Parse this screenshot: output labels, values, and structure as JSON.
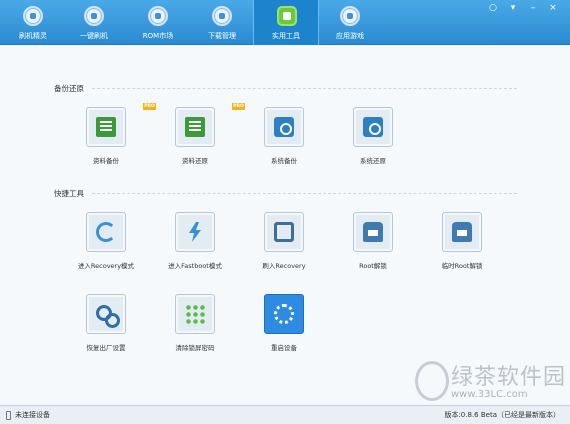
{
  "nav": [
    {
      "label": "刷机精灵",
      "icon": "s-logo-icon"
    },
    {
      "label": "一键刷机",
      "icon": "cursor-icon"
    },
    {
      "label": "ROM市场",
      "icon": "rom-icon"
    },
    {
      "label": "下载管理",
      "icon": "download-icon"
    },
    {
      "label": "实用工具",
      "icon": "grid-icon",
      "active": true
    },
    {
      "label": "应用游戏",
      "icon": "game-icon"
    }
  ],
  "window_controls": {
    "skin": "○",
    "menu": "▾",
    "minimize": "–",
    "close": "×"
  },
  "sections": {
    "backup": "备份还原",
    "quick": "快捷工具"
  },
  "backup_tools": [
    {
      "label": "资料备份",
      "badge": "PRO"
    },
    {
      "label": "资料还原",
      "badge": "PRO"
    },
    {
      "label": "系统备份"
    },
    {
      "label": "系统还原"
    }
  ],
  "quick_tools": [
    {
      "label": "进入Recovery模式"
    },
    {
      "label": "进入Fastboot模式"
    },
    {
      "label": "刷入Recovery"
    },
    {
      "label": "Root解锁"
    },
    {
      "label": "临时Root解锁"
    },
    {
      "label": "恢复出厂设置"
    },
    {
      "label": "清除锁屏密码"
    },
    {
      "label": "重启设备"
    }
  ],
  "status": {
    "device": "未连接设备",
    "version": "版本:0.8.6 Beta（已经是最新版本）"
  },
  "watermark": {
    "title": "绿茶软件园",
    "url": "www.33LC.com"
  },
  "colors": {
    "accent": "#2b8bd2",
    "active_tab": "#1d83cc",
    "pro_badge": "#f6b21a"
  }
}
